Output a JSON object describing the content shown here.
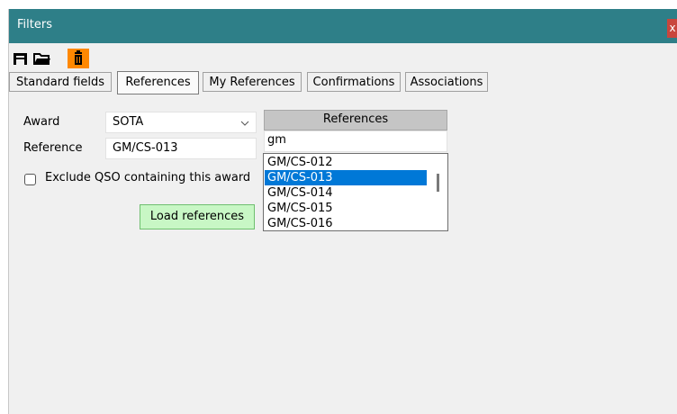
{
  "window": {
    "title": "Filters",
    "close_glyph": "x"
  },
  "toolbar": {
    "icons": [
      "save-icon",
      "open-folder-icon",
      "delete-icon"
    ],
    "delete_bg": "#ff8800"
  },
  "tabs": [
    {
      "label": "Standard fields",
      "active": false
    },
    {
      "label": "References",
      "active": true
    },
    {
      "label": "My References",
      "active": false
    },
    {
      "label": "Confirmations",
      "active": false
    },
    {
      "label": "Associations",
      "active": false
    }
  ],
  "form": {
    "award_label": "Award",
    "award_value": "SOTA",
    "reference_label": "Reference",
    "reference_value": "GM/CS-013",
    "exclude_label": "Exclude QSO containing this award",
    "exclude_checked": false,
    "load_button": "Load references",
    "load_button_color": "#c8f7c5"
  },
  "references_panel": {
    "header": "References",
    "search_value": "gm",
    "items": [
      "GM/CS-012",
      "GM/CS-013",
      "GM/CS-014",
      "GM/CS-015",
      "GM/CS-016"
    ],
    "selected_item": "GM/CS-013"
  },
  "colors": {
    "titlebar": "#2e7f88",
    "selection": "#0078d7",
    "close": "#c9463d"
  }
}
